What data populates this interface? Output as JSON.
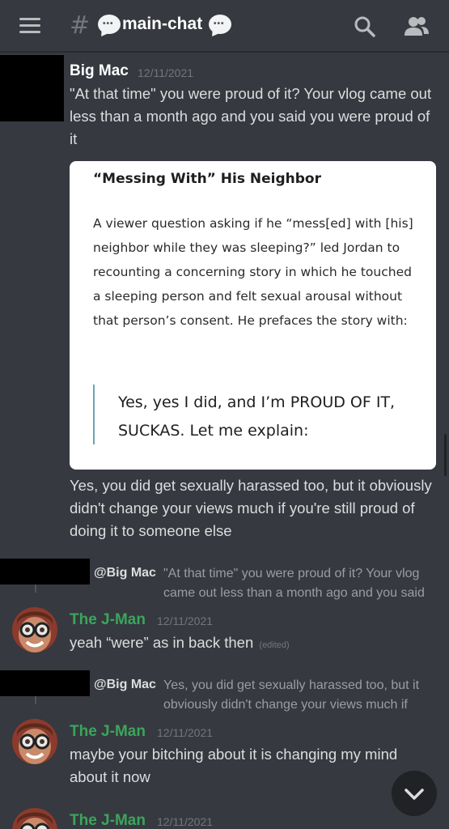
{
  "header": {
    "channel_name": "main-chat",
    "menu_icon": "hamburger-icon",
    "search_icon": "search-icon",
    "members_icon": "members-icon"
  },
  "messages": [
    {
      "username": "Big Mac",
      "timestamp": "12/11/2021",
      "text": "\"At that time\" you were proud of it? Your vlog came out less than a month ago and you said you were proud of it",
      "embed": {
        "title": "“Messing With” His Neighbor",
        "body": "A viewer question asking if he “mess[ed] with [his] neighbor while they was sleeping?” led Jordan to recounting a concerning story in which he touched a sleeping person and felt sexual arousal without that person’s consent. He prefaces the story with:",
        "quote": "Yes, yes I did, and I’m PROUD OF IT, SUCKAS. Let me explain:"
      },
      "followup": "Yes, you did get sexually harassed too, but it obviously didn't change your views much if you're still proud of doing it to someone else"
    },
    {
      "reply_to": "@Big Mac",
      "reply_preview": "\"At that time\" you were proud of it? Your vlog came out less than a month ago and you said you ...",
      "username": "The J-Man",
      "timestamp": "12/11/2021",
      "text": "yeah “were” as in back then",
      "edited": "(edited)"
    },
    {
      "reply_to": "@Big Mac",
      "reply_preview": "Yes, you did get sexually harassed too, but it obviously didn't change your views much if you're still...",
      "username": "The J-Man",
      "timestamp": "12/11/2021",
      "text": "maybe your bitching about it is changing my mind about it now"
    },
    {
      "username": "The J-Man",
      "timestamp": "12/11/2021"
    }
  ],
  "colors": {
    "background": "#36393f",
    "jman_name": "#3ba55c",
    "bigmac_name": "#ffffff",
    "embed_bg": "#ffffff"
  },
  "scroll_down_icon": "chevron-down-icon"
}
